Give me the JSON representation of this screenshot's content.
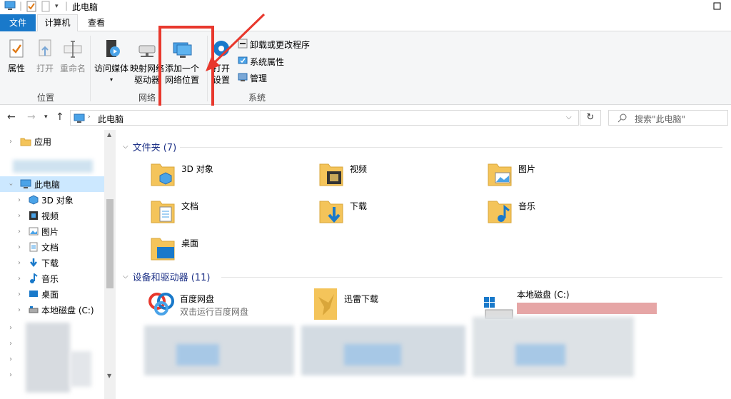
{
  "window": {
    "title": "此电脑"
  },
  "ribbon_tabs": {
    "file": "文件",
    "computer": "计算机",
    "view": "查看"
  },
  "ribbon": {
    "location_group": {
      "label": "位置",
      "properties": "属性",
      "open": "打开",
      "rename": "重命名"
    },
    "network_group": {
      "label": "网络",
      "access_media": "访问媒体",
      "map_drive_line1": "映射网络",
      "map_drive_line2": "驱动器",
      "add_network_line1": "添加一个",
      "add_network_line2": "网络位置"
    },
    "system_group": {
      "label": "系统",
      "open_settings_line1": "打开",
      "open_settings_line2": "设置",
      "uninstall": "卸载或更改程序",
      "system_properties": "系统属性",
      "manage": "管理"
    }
  },
  "address": {
    "path": "此电脑",
    "search_placeholder": "搜索\"此电脑\""
  },
  "nav_pane": {
    "items": [
      {
        "label": "应用"
      },
      {
        "label": "此电脑"
      },
      {
        "label": "3D 对象"
      },
      {
        "label": "视频"
      },
      {
        "label": "图片"
      },
      {
        "label": "文档"
      },
      {
        "label": "下载"
      },
      {
        "label": "音乐"
      },
      {
        "label": "桌面"
      },
      {
        "label": "本地磁盘 (C:)"
      }
    ]
  },
  "content": {
    "folders_header": "文件夹 (7)",
    "folders": [
      {
        "label": "3D 对象"
      },
      {
        "label": "视频"
      },
      {
        "label": "图片"
      },
      {
        "label": "文档"
      },
      {
        "label": "下载"
      },
      {
        "label": "音乐"
      },
      {
        "label": "桌面"
      }
    ],
    "devices_header": "设备和驱动器 (11)",
    "devices": [
      {
        "label": "百度网盘",
        "sublabel": "双击运行百度网盘"
      },
      {
        "label": "迅雷下载"
      },
      {
        "label": "本地磁盘 (C:)"
      }
    ]
  },
  "colors": {
    "file_tab": "#1979ca",
    "annotation_red": "#e8382d",
    "nav_selected": "#cce8ff",
    "section_header": "#1e3287"
  }
}
